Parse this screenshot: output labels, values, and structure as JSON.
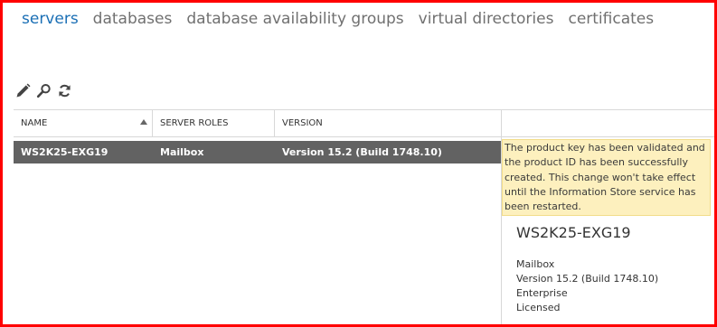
{
  "tabs": [
    {
      "label": "servers",
      "active": true
    },
    {
      "label": "databases",
      "active": false
    },
    {
      "label": "database availability groups",
      "active": false
    },
    {
      "label": "virtual directories",
      "active": false
    },
    {
      "label": "certificates",
      "active": false
    }
  ],
  "toolbar": {
    "icons": [
      "edit-icon",
      "search-icon",
      "refresh-icon"
    ]
  },
  "table": {
    "columns": [
      "NAME",
      "SERVER ROLES",
      "VERSION"
    ],
    "sort": {
      "column": "NAME",
      "direction": "ascending"
    },
    "rows": [
      {
        "name": "WS2K25-EXG19",
        "roles": "Mailbox",
        "version": "Version 15.2 (Build 1748.10)",
        "selected": true
      }
    ]
  },
  "details": {
    "notice": "The product key has been validated and the product ID has been successfully created. This change won't take effect until the Information Store service has been restarted.",
    "title": "WS2K25-EXG19",
    "lines": [
      "Mailbox",
      "Version 15.2 (Build 1748.10)",
      "Enterprise",
      "Licensed"
    ]
  },
  "colors": {
    "accent": "#1a6fb5",
    "selected_row": "#626262",
    "notice_bg": "#fdf0be",
    "frame": "#ff0000"
  }
}
